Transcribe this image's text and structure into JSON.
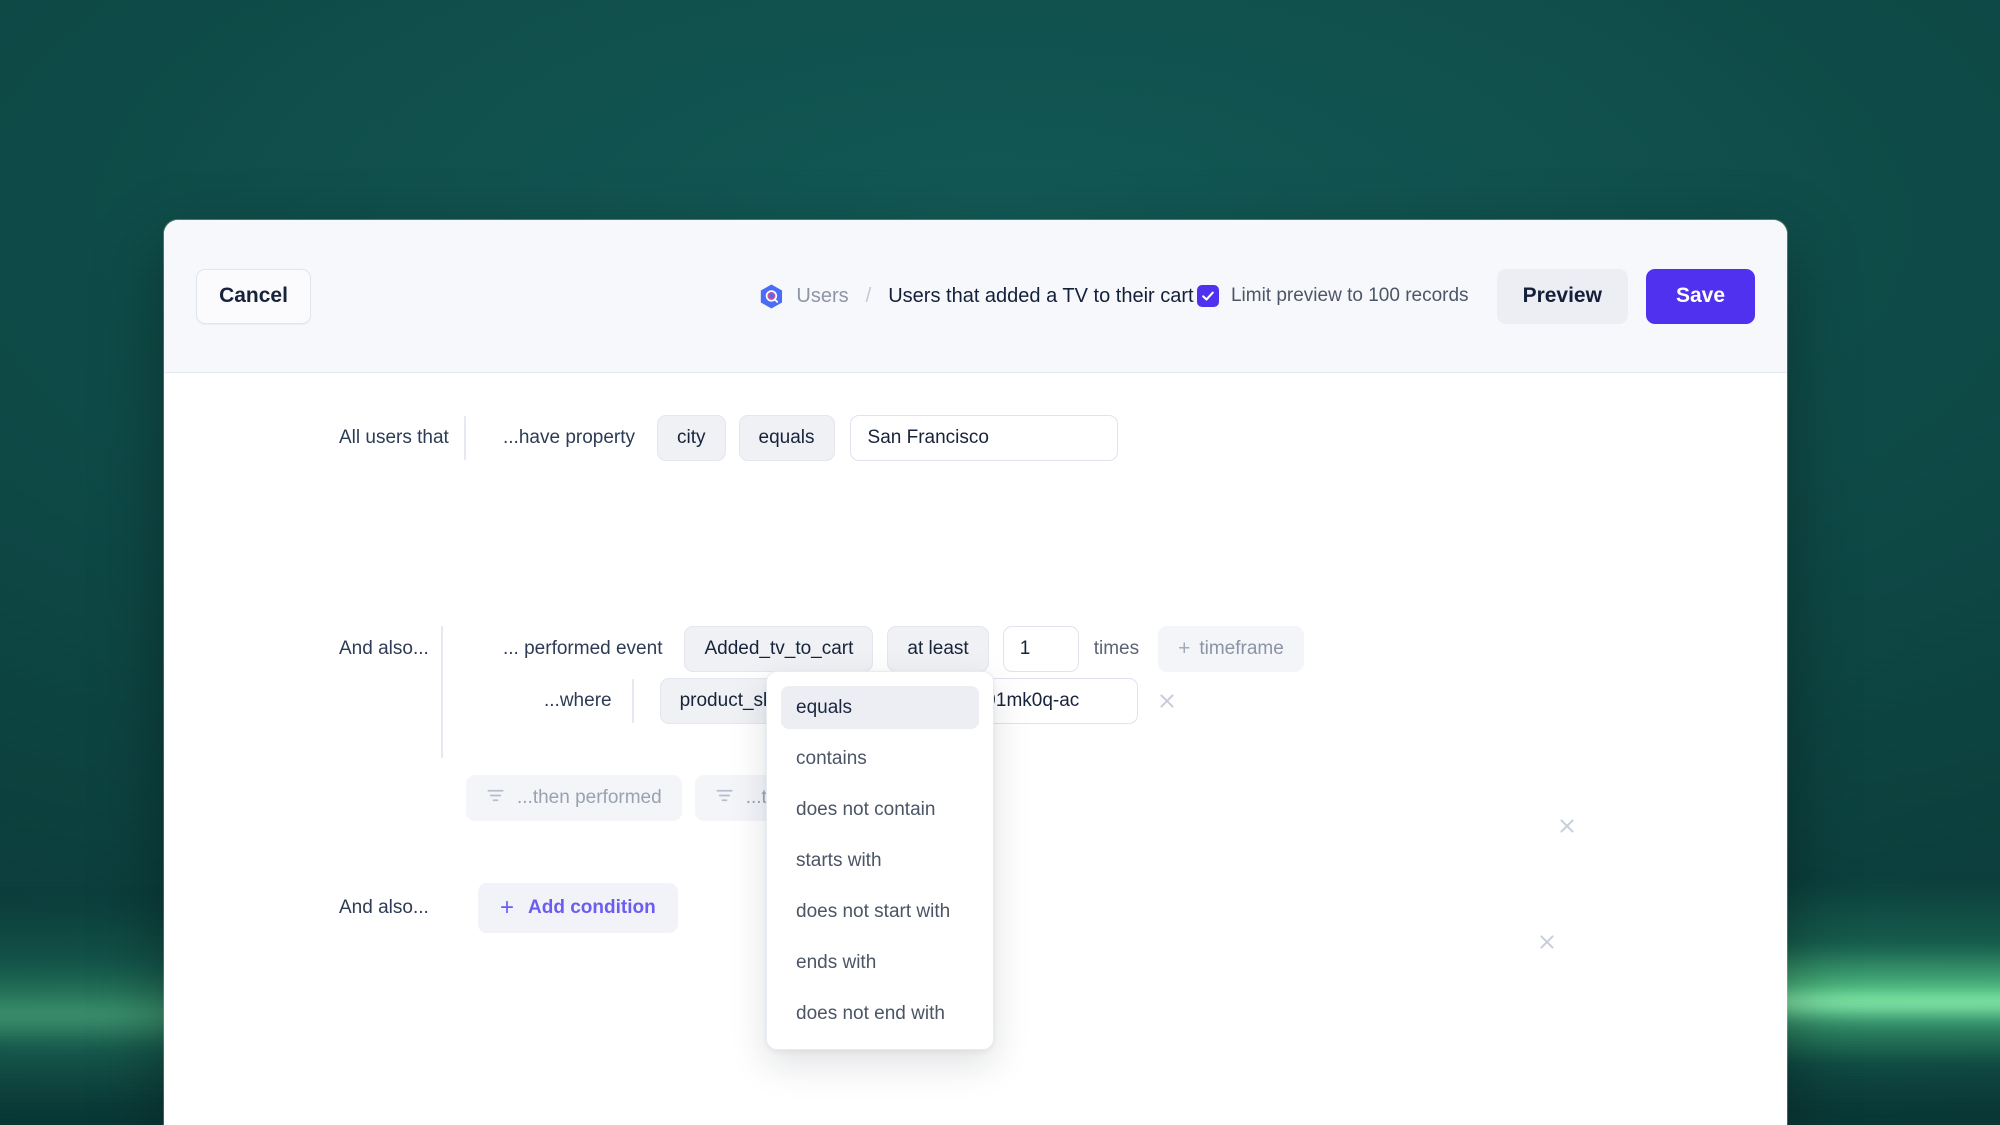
{
  "header": {
    "cancel_label": "Cancel",
    "breadcrumb": {
      "icon": "users-hexagon-icon",
      "parent": "Users",
      "separator": "/",
      "current": "Users that added a TV to their cart"
    },
    "limit_checkbox": {
      "checked": true,
      "label": "Limit preview to 100 records"
    },
    "preview_label": "Preview",
    "save_label": "Save"
  },
  "colors": {
    "accent": "#4f31ef",
    "accent_text": "#6c5df0",
    "background": "#0c4744",
    "glow": "#96ffb9",
    "chip_bg": "#eff1f5",
    "card_bg": "#ffffff"
  },
  "builder": {
    "condition1": {
      "prefix": "All users that",
      "clause": "...have property",
      "property": "city",
      "operator": "equals",
      "value": "San Francisco",
      "remove_icon": "close-icon"
    },
    "condition2": {
      "prefix": "And also...",
      "clause": "... performed event",
      "event": "Added_tv_to_cart",
      "frequency_operator": "at least",
      "count": "1",
      "count_unit": "times",
      "timeframe_label": "timeframe",
      "timeframe_plus": "+",
      "remove_icon": "close-icon",
      "where": {
        "clause": "...where",
        "property": "product_sku",
        "operator": "equals",
        "value": "6c7291mk0q-ac",
        "remove_icon": "close-icon"
      },
      "then_filters": [
        {
          "icon": "funnel-icon",
          "label": "...then performed"
        },
        {
          "icon": "funnel-icon",
          "label": "...then did"
        }
      ]
    },
    "add_row": {
      "prefix": "And also...",
      "plus": "+",
      "label": "Add condition"
    }
  },
  "operator_dropdown": {
    "selected": "equals",
    "options": [
      "equals",
      "contains",
      "does not contain",
      "starts with",
      "does not start with",
      "ends with",
      "does not end with"
    ]
  }
}
